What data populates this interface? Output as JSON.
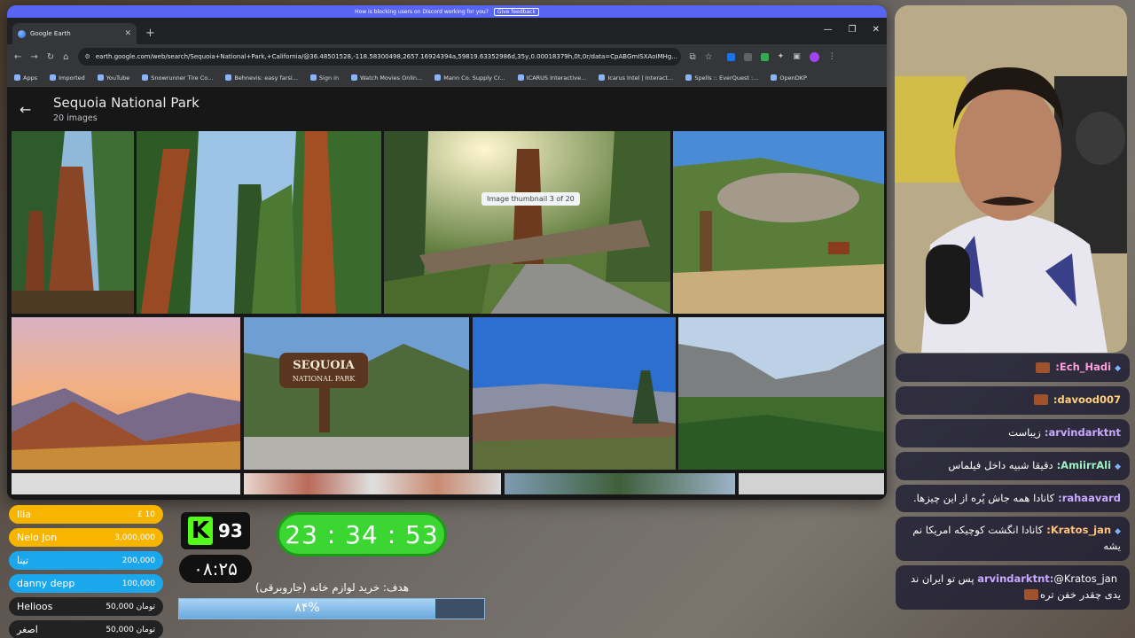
{
  "discord": {
    "text": "How is blocking users on Discord working for you?",
    "button": "Give feedback"
  },
  "browser": {
    "tab_title": "Google Earth",
    "url": "earth.google.com/web/search/Sequoia+National+Park,+California/@36.48501528,-118.58300498,2657.16924394a,59819.63352986d,35y,0.00018379h,0t,0r/data=CpABGmISXAoIMHg...",
    "bookmarks": [
      "Apps",
      "Imported",
      "YouTube",
      "Snowrunner Tire Co...",
      "Behnevis: easy farsi...",
      "Sign in",
      "Watch Movies Onlin...",
      "Mann Co. Supply Cr...",
      "ICARUS Interactive...",
      "Icarus Intel | Interact...",
      "Spells :: EverQuest :...",
      "OpenDKP"
    ]
  },
  "gallery": {
    "title": "Sequoia National Park",
    "subtitle": "20 images",
    "tooltip": "Image thumbnail 3 of 20",
    "sign_line1": "SEQUOIA",
    "sign_line2": "NATIONAL PARK"
  },
  "chat": [
    {
      "user": "Ech_Hadi:",
      "message": "",
      "emote": true,
      "badge": true
    },
    {
      "user": "davood007:",
      "message": "",
      "emote": true,
      "badge": false
    },
    {
      "user": "arvindarktnt:",
      "message": "زیباست",
      "emote": false,
      "badge": false
    },
    {
      "user": "AmiirrAli:",
      "message": "دقیقا شبیه داخل فیلماس",
      "emote": false,
      "badge": true
    },
    {
      "user": "rahaavard:",
      "message": "کانادا همه جاش پُره از این چیزها.",
      "emote": false,
      "badge": false
    },
    {
      "user": "Kratos_jan:",
      "message": "کانادا انگشت کوچیکه امریکا نم یشه",
      "emote": false,
      "badge": true
    },
    {
      "user": "arvindarktnt:",
      "message": "@Kratos_jan پس تو ایران ند یدی چقدر خفن تره",
      "emote": true,
      "badge": false
    }
  ],
  "donations": [
    {
      "name": "Ilia",
      "amount": "£ 10",
      "color": "#f7b500"
    },
    {
      "name": "Nelo Jon",
      "amount": "3,000,000",
      "color": "#f7b500"
    },
    {
      "name": "تینا",
      "amount": "200,000",
      "color": "#1aa7ec"
    },
    {
      "name": "danny depp",
      "amount": "100,000",
      "color": "#1aa7ec"
    },
    {
      "name": "Helioos",
      "amount": "50,000 تومان",
      "color": "#222222"
    },
    {
      "name": "اصغر",
      "amount": "50,000 تومان",
      "color": "#222222"
    }
  ],
  "kick": {
    "logo": "K",
    "viewers": "93"
  },
  "clock": "۰۸:۲۵",
  "timer": "23 : 34 : 53",
  "goal": {
    "label": "هدف: خرید لوازم خانه (جاروبرقی)",
    "percent_text": "۸۴%",
    "progress": 0.84
  },
  "colors": {
    "kick_green": "#53fc18",
    "timer_green": "#3bd631",
    "discord": "#5865f2"
  }
}
